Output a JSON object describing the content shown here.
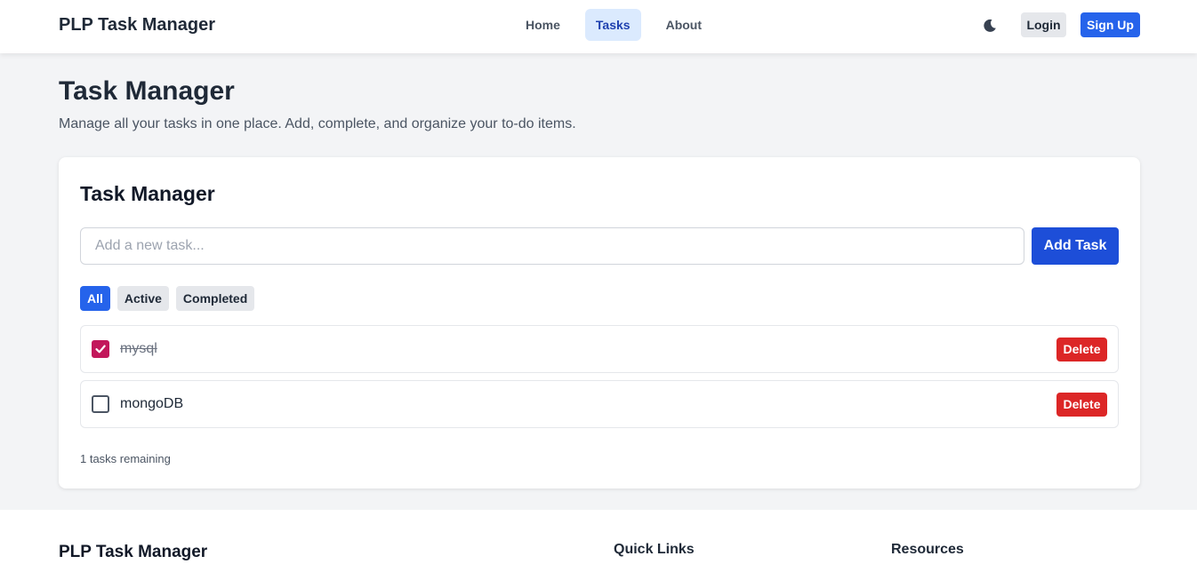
{
  "navbar": {
    "brand": "PLP Task Manager",
    "links": [
      {
        "label": "Home",
        "active": false
      },
      {
        "label": "Tasks",
        "active": true
      },
      {
        "label": "About",
        "active": false
      }
    ],
    "theme_icon": "moon-icon",
    "login_label": "Login",
    "signup_label": "Sign Up"
  },
  "page": {
    "title": "Task Manager",
    "subtitle": "Manage all your tasks in one place. Add, complete, and organize your to-do items."
  },
  "card": {
    "title": "Task Manager",
    "input_placeholder": "Add a new task...",
    "input_value": "",
    "add_label": "Add Task",
    "filters": [
      {
        "label": "All",
        "active": true
      },
      {
        "label": "Active",
        "active": false
      },
      {
        "label": "Completed",
        "active": false
      }
    ],
    "tasks": [
      {
        "text": "mysql",
        "completed": true,
        "delete_label": "Delete"
      },
      {
        "text": "mongoDB",
        "completed": false,
        "delete_label": "Delete"
      }
    ],
    "remaining": "1 tasks remaining"
  },
  "footer": {
    "brand": "PLP Task Manager",
    "quick_links_heading": "Quick Links",
    "resources_heading": "Resources"
  },
  "colors": {
    "primary": "#2563eb",
    "danger": "#dc2626",
    "checkbox_checked": "#c2185b",
    "active_nav_bg": "#dbeafe"
  }
}
